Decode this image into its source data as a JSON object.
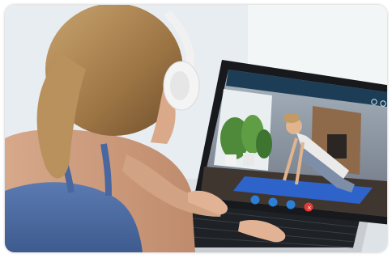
{
  "scene": {
    "subject": "woman-with-headphones-on-video-call",
    "icons": [
      "video-call-window",
      "yoga-instructor-video",
      "call-controls"
    ]
  },
  "call_window": {
    "top_icons": [
      "minimize-icon",
      "close-icon"
    ],
    "controls": [
      {
        "name": "mic-button",
        "color": "#2b7fd6"
      },
      {
        "name": "camera-button",
        "color": "#2b7fd6"
      },
      {
        "name": "chat-button",
        "color": "#2b7fd6"
      },
      {
        "name": "end-call-button",
        "color": "#e53935"
      }
    ]
  },
  "colors": {
    "titlebar": "#1d3d57",
    "mat": "#2e63c9",
    "sports_bra": "#4f6fa6",
    "headphones": "#f1f1f1"
  }
}
